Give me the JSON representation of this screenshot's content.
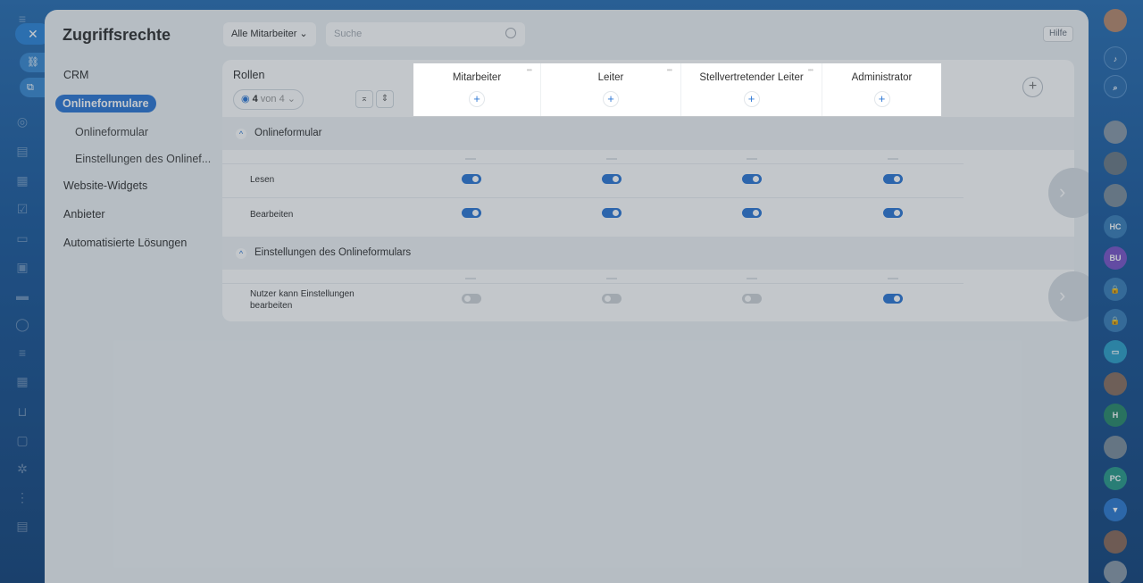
{
  "page": {
    "title": "Zugriffsrechte",
    "help_label": "Hilfe"
  },
  "filters": {
    "employee_filter": "Alle Mitarbeiter",
    "search_placeholder": "Suche"
  },
  "nav": {
    "crm": "CRM",
    "active": "Onlineformulare",
    "sub1": "Onlineformular",
    "sub2": "Einstellungen des Onlinef...",
    "widgets": "Website-Widgets",
    "providers": "Anbieter",
    "automation": "Automatisierte Lösungen"
  },
  "table": {
    "roles_label": "Rollen",
    "visible_count": "4",
    "visible_total": "von 4",
    "roles": [
      "Mitarbeiter",
      "Leiter",
      "Stellvertretender Leiter",
      "Administrator"
    ],
    "sections": [
      {
        "label": "Onlineformular",
        "rows": [
          {
            "label": "Lesen",
            "values": [
              true,
              true,
              true,
              true
            ]
          },
          {
            "label": "Bearbeiten",
            "values": [
              true,
              true,
              true,
              true
            ]
          }
        ]
      },
      {
        "label": "Einstellungen des Onlineformulars",
        "rows": [
          {
            "label": "Nutzer kann Einstellungen bearbeiten",
            "values": [
              false,
              false,
              false,
              true
            ]
          }
        ]
      }
    ]
  },
  "rail": {
    "badge1": "HC",
    "badge2": "BU",
    "badge3": "H",
    "badge4": "PC"
  },
  "colors": {
    "accent": "#2f78d5",
    "toggle_off": "#d0d4d8"
  }
}
